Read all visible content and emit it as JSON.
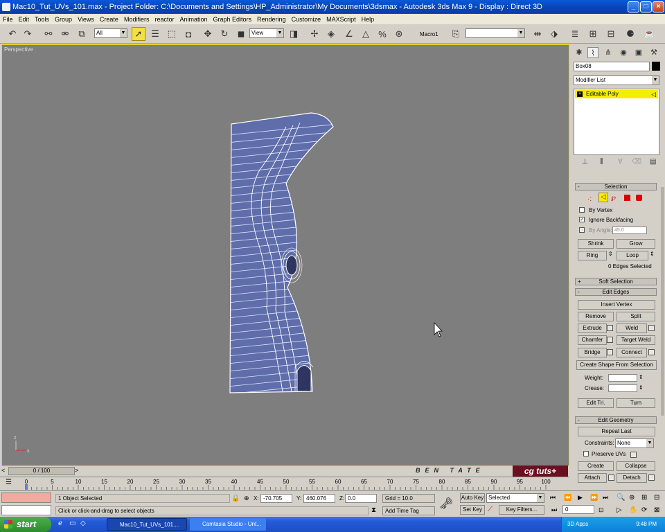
{
  "window": {
    "title": "Mac10_Tut_UVs_101.max    - Project Folder: C:\\Documents and Settings\\HP_Administrator\\My Documents\\3dsmax    - Autodesk 3ds Max 9         - Display : Direct 3D",
    "min": "_",
    "max": "□",
    "close": "×"
  },
  "menu": [
    "File",
    "Edit",
    "Tools",
    "Group",
    "Views",
    "Create",
    "Modifiers",
    "reactor",
    "Animation",
    "Graph Editors",
    "Rendering",
    "Customize",
    "MAXScript",
    "Help"
  ],
  "toolbar": {
    "filter_value": "All",
    "refcoord_value": "View",
    "macro_label": "Macro1",
    "named_sel_value": ""
  },
  "viewport": {
    "label": "Perspective"
  },
  "command_panel": {
    "object_name": "Box08",
    "object_color": "#000000",
    "modifier_list_label": "Modifier List",
    "stack_item": "Editable Poly",
    "selection": {
      "header": "Selection",
      "by_vertex": "By Vertex",
      "ignore_backfacing": "Ignore Backfacing",
      "by_angle": "By Angle:",
      "angle_value": "45.0",
      "shrink": "Shrink",
      "grow": "Grow",
      "ring": "Ring",
      "loop": "Loop",
      "status": "0 Edges Selected"
    },
    "soft_selection": "Soft Selection",
    "edit_edges": {
      "header": "Edit Edges",
      "insert_vertex": "Insert Vertex",
      "remove": "Remove",
      "split": "Split",
      "extrude": "Extrude",
      "weld": "Weld",
      "chamfer": "Chamfer",
      "target_weld": "Target Weld",
      "bridge": "Bridge",
      "connect": "Connect",
      "create_shape": "Create Shape From Selection",
      "weight": "Weight:",
      "crease": "Crease:",
      "edit_tri": "Edit Tri.",
      "turn": "Turn"
    },
    "edit_geometry": {
      "header": "Edit Geometry",
      "repeat_last": "Repeat Last",
      "constraints": "Constraints:",
      "constraints_value": "None",
      "preserve_uvs": "Preserve UVs",
      "create": "Create",
      "collapse": "Collapse",
      "attach": "Attach",
      "detach": "Detach"
    }
  },
  "timeline": {
    "slider_label": "0 / 100",
    "ticks": [
      "0",
      "5",
      "10",
      "15",
      "20",
      "25",
      "30",
      "35",
      "40",
      "45",
      "50",
      "55",
      "60",
      "65",
      "70",
      "75",
      "80",
      "85",
      "90",
      "95",
      "100"
    ]
  },
  "branding": {
    "name": "BEN TATE",
    "logo": "cg tuts+"
  },
  "status": {
    "selection": "1 Object Selected",
    "prompt": "Click or click-and-drag to select objects",
    "x_label": "X:",
    "x_value": "-70.705",
    "y_label": "Y:",
    "y_value": "460.076",
    "z_label": "Z:",
    "z_value": "0.0",
    "grid": "Grid = 10.0",
    "add_time_tag": "Add Time Tag",
    "auto_key": "Auto Key",
    "set_key": "Set Key",
    "selected_value": "Selected",
    "key_filters": "Key Filters...",
    "frame_value": "0"
  },
  "taskbar": {
    "start": "start",
    "tasks": [
      "Mac10_Tut_UVs_101....",
      "Camtasia Studio - Unt..."
    ],
    "tray_text": "3D    Apps",
    "clock": "9:48 PM"
  }
}
